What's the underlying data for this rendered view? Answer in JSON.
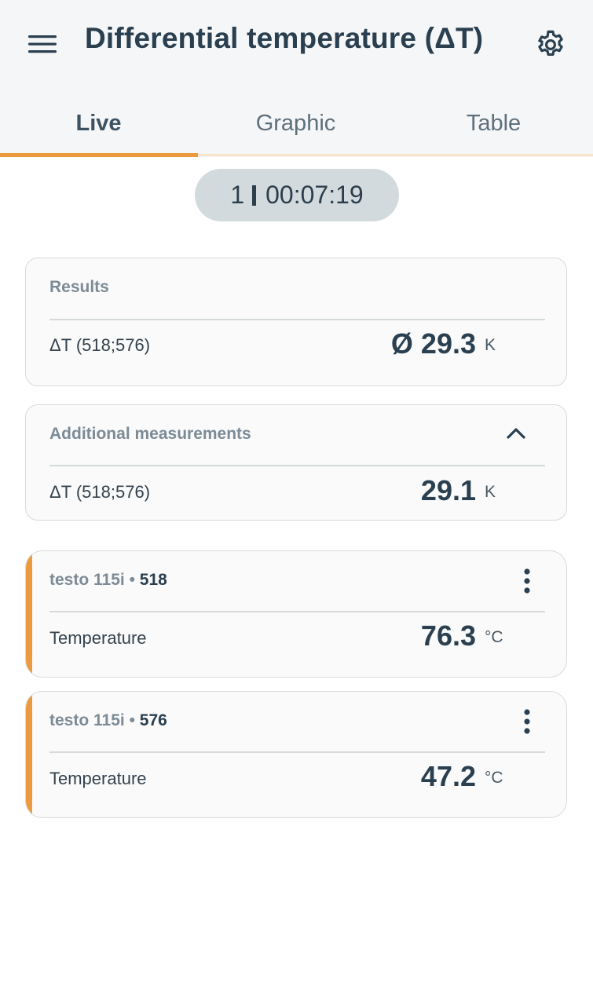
{
  "header": {
    "title": "Differential temperature (ΔT)",
    "menu_icon": "hamburger-menu-icon",
    "settings_icon": "gear-icon"
  },
  "tabs": [
    {
      "label": "Live",
      "active": true
    },
    {
      "label": "Graphic",
      "active": false
    },
    {
      "label": "Table",
      "active": false
    }
  ],
  "timer": {
    "index": "1",
    "elapsed": "00:07:19"
  },
  "results": {
    "title": "Results",
    "row": {
      "label": "ΔT (518;576)",
      "value": "Ø 29.3",
      "unit": "K"
    }
  },
  "additional": {
    "title": "Additional measurements",
    "collapse_icon": "chevron-up-icon",
    "row": {
      "label": "ΔT (518;576)",
      "value": "29.1",
      "unit": "K"
    }
  },
  "probes": [
    {
      "device": "testo 115i",
      "separator": "•",
      "serial": "518",
      "measurement": "Temperature",
      "value": "76.3",
      "unit": "°C"
    },
    {
      "device": "testo 115i",
      "separator": "•",
      "serial": "576",
      "measurement": "Temperature",
      "value": "47.2",
      "unit": "°C"
    }
  ],
  "colors": {
    "accent": "#eb9b3e",
    "title_text": "#2a3f4f",
    "header_bg": "#f5f6f7",
    "pill_bg": "#d3dade"
  }
}
